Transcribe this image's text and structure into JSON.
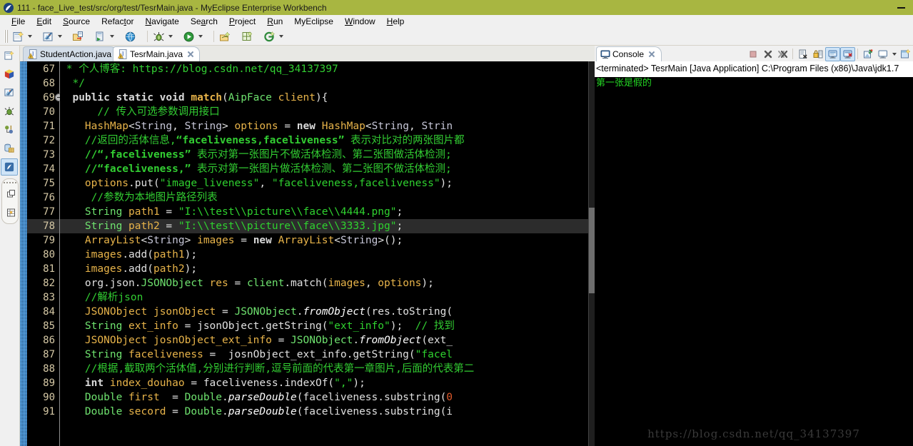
{
  "window": {
    "title": "111 - face_Live_test/src/org/test/TesrMain.java - MyEclipse Enterprise Workbench",
    "title_icon": "myeclipse-icon",
    "minimize_label": "minimize-button",
    "titlebar_color": "#a8b641"
  },
  "menubar": {
    "items": [
      {
        "label": "File",
        "mnemonic": "F"
      },
      {
        "label": "Edit",
        "mnemonic": "E"
      },
      {
        "label": "Source",
        "mnemonic": "S"
      },
      {
        "label": "Refactor",
        "mnemonic": "t"
      },
      {
        "label": "Navigate",
        "mnemonic": "N"
      },
      {
        "label": "Search",
        "mnemonic": "a"
      },
      {
        "label": "Project",
        "mnemonic": "P"
      },
      {
        "label": "Run",
        "mnemonic": "R"
      },
      {
        "label": "MyEclipse",
        "mnemonic": ""
      },
      {
        "label": "Window",
        "mnemonic": "W"
      },
      {
        "label": "Help",
        "mnemonic": "H"
      }
    ]
  },
  "toolbar": {
    "buttons": [
      {
        "name": "new-wizard-icon",
        "has_dropdown": true
      },
      {
        "name": "open-myeclipse-icon",
        "has_dropdown": true
      },
      {
        "name": "save-deploy-icon",
        "has_dropdown": false
      },
      {
        "name": "run-server-icon",
        "has_dropdown": true
      },
      {
        "name": "open-browser-icon",
        "has_dropdown": false
      },
      {
        "name": "debug-icon",
        "has_dropdown": true
      },
      {
        "name": "run-icon",
        "has_dropdown": true
      },
      {
        "name": "external-tools-icon",
        "has_dropdown": false
      },
      {
        "name": "new-window-icon",
        "has_dropdown": false
      },
      {
        "name": "search-git-icon",
        "has_dropdown": true
      }
    ]
  },
  "leftbar": {
    "items": [
      {
        "name": "new-wizard-icon",
        "selected": false
      },
      {
        "name": "package-cube-icon",
        "selected": false
      },
      {
        "name": "myeclipse-explorer-icon",
        "selected": false
      },
      {
        "name": "debug-bug-icon",
        "selected": false
      },
      {
        "name": "hierarchy-icon",
        "selected": false
      },
      {
        "name": "database-icon",
        "selected": false
      },
      {
        "name": "java-perspective-icon",
        "selected": true
      }
    ],
    "pill_items": [
      {
        "name": "restore-view-icon"
      },
      {
        "name": "table-view-icon"
      }
    ]
  },
  "editor": {
    "tabs": [
      {
        "label": "StudentAction.java",
        "icon": "java-warning-icon",
        "active": false,
        "closable": false
      },
      {
        "label": "TesrMain.java",
        "icon": "java-warning-icon",
        "active": true,
        "closable": true
      }
    ],
    "highlighted_line": 78,
    "fold_marker_line": 69,
    "first_line": 67,
    "lines": [
      {
        "n": 67,
        "tokens": [
          {
            "t": " * ",
            "c": "cmt"
          },
          {
            "t": "个人博客: https://blog.csdn.net/qq_34137397",
            "c": "cmt"
          }
        ]
      },
      {
        "n": 68,
        "tokens": [
          {
            "t": "  */",
            "c": "cmt"
          }
        ]
      },
      {
        "n": 69,
        "tokens": [
          {
            "t": "  ",
            "c": "plain"
          },
          {
            "t": "public static void ",
            "c": "kw"
          },
          {
            "t": "match",
            "c": "meth-b"
          },
          {
            "t": "(",
            "c": "plain"
          },
          {
            "t": "AipFace",
            "c": "type"
          },
          {
            "t": " client",
            "c": "var"
          },
          {
            "t": "){",
            "c": "plain"
          }
        ]
      },
      {
        "n": 70,
        "tokens": [
          {
            "t": "      ",
            "c": "plain"
          },
          {
            "t": "// 传入可选参数调用接口",
            "c": "cmt"
          }
        ]
      },
      {
        "n": 71,
        "tokens": [
          {
            "t": "    ",
            "c": "plain"
          },
          {
            "t": "HashMap",
            "c": "cls"
          },
          {
            "t": "<",
            "c": "plain"
          },
          {
            "t": "String",
            "c": "gen"
          },
          {
            "t": ", ",
            "c": "plain"
          },
          {
            "t": "String",
            "c": "gen"
          },
          {
            "t": "> ",
            "c": "plain"
          },
          {
            "t": "options",
            "c": "var"
          },
          {
            "t": " = ",
            "c": "plain"
          },
          {
            "t": "new",
            "c": "kw"
          },
          {
            "t": " ",
            "c": "plain"
          },
          {
            "t": "HashMap",
            "c": "cls"
          },
          {
            "t": "<",
            "c": "plain"
          },
          {
            "t": "String",
            "c": "gen"
          },
          {
            "t": ", ",
            "c": "plain"
          },
          {
            "t": "Strin",
            "c": "gen"
          }
        ]
      },
      {
        "n": 72,
        "tokens": [
          {
            "t": "    ",
            "c": "plain"
          },
          {
            "t": "//返回的活体信息,",
            "c": "cmt"
          },
          {
            "t": "“faceliveness,faceliveness”",
            "c": "cmt-b"
          },
          {
            "t": " 表示对比对的两张图片都",
            "c": "cmt"
          }
        ]
      },
      {
        "n": 73,
        "tokens": [
          {
            "t": "    ",
            "c": "plain"
          },
          {
            "t": "//“,faceliveness”",
            "c": "cmt-b"
          },
          {
            "t": " 表示对第一张图片不做活体检测、第二张图做活体检测;",
            "c": "cmt"
          }
        ]
      },
      {
        "n": 74,
        "tokens": [
          {
            "t": "    ",
            "c": "plain"
          },
          {
            "t": "//“faceliveness,”",
            "c": "cmt-b"
          },
          {
            "t": " 表示对第一张图片做活体检测、第二张图不做活体检测;",
            "c": "cmt"
          }
        ]
      },
      {
        "n": 75,
        "tokens": [
          {
            "t": "    ",
            "c": "plain"
          },
          {
            "t": "options",
            "c": "var"
          },
          {
            "t": ".put(",
            "c": "plain"
          },
          {
            "t": "\"image_liveness\"",
            "c": "str"
          },
          {
            "t": ", ",
            "c": "plain"
          },
          {
            "t": "\"faceliveness,faceliveness\"",
            "c": "str"
          },
          {
            "t": ");",
            "c": "plain"
          }
        ]
      },
      {
        "n": 76,
        "tokens": [
          {
            "t": "     ",
            "c": "plain"
          },
          {
            "t": "//参数为本地图片路径列表",
            "c": "cmt"
          }
        ]
      },
      {
        "n": 77,
        "tokens": [
          {
            "t": "    ",
            "c": "plain"
          },
          {
            "t": "String",
            "c": "type"
          },
          {
            "t": " path1",
            "c": "var"
          },
          {
            "t": " = ",
            "c": "plain"
          },
          {
            "t": "\"I:\\\\test\\\\picture\\\\face\\\\4444.png\"",
            "c": "str"
          },
          {
            "t": ";",
            "c": "plain"
          }
        ]
      },
      {
        "n": 78,
        "tokens": [
          {
            "t": "    ",
            "c": "plain"
          },
          {
            "t": "String",
            "c": "type"
          },
          {
            "t": " path2",
            "c": "var"
          },
          {
            "t": " = ",
            "c": "plain"
          },
          {
            "t": "\"I:\\\\test\\\\picture\\\\face\\\\3333.jpg\"",
            "c": "str"
          },
          {
            "t": ";",
            "c": "plain"
          }
        ]
      },
      {
        "n": 79,
        "tokens": [
          {
            "t": "    ",
            "c": "plain"
          },
          {
            "t": "ArrayList",
            "c": "cls"
          },
          {
            "t": "<",
            "c": "plain"
          },
          {
            "t": "String",
            "c": "gen"
          },
          {
            "t": "> ",
            "c": "plain"
          },
          {
            "t": "images",
            "c": "var"
          },
          {
            "t": " = ",
            "c": "plain"
          },
          {
            "t": "new",
            "c": "kw"
          },
          {
            "t": " ",
            "c": "plain"
          },
          {
            "t": "ArrayList",
            "c": "cls"
          },
          {
            "t": "<",
            "c": "plain"
          },
          {
            "t": "String",
            "c": "gen"
          },
          {
            "t": ">();",
            "c": "plain"
          }
        ]
      },
      {
        "n": 80,
        "tokens": [
          {
            "t": "    ",
            "c": "plain"
          },
          {
            "t": "images",
            "c": "var"
          },
          {
            "t": ".add(",
            "c": "plain"
          },
          {
            "t": "path1",
            "c": "var"
          },
          {
            "t": ");",
            "c": "plain"
          }
        ]
      },
      {
        "n": 81,
        "tokens": [
          {
            "t": "    ",
            "c": "plain"
          },
          {
            "t": "images",
            "c": "var"
          },
          {
            "t": ".add(",
            "c": "plain"
          },
          {
            "t": "path2",
            "c": "var"
          },
          {
            "t": ");",
            "c": "plain"
          }
        ]
      },
      {
        "n": 82,
        "tokens": [
          {
            "t": "    ",
            "c": "plain"
          },
          {
            "t": "org.json.",
            "c": "plain"
          },
          {
            "t": "JSONObject",
            "c": "type"
          },
          {
            "t": " res",
            "c": "var"
          },
          {
            "t": " = ",
            "c": "plain"
          },
          {
            "t": "client",
            "c": "type"
          },
          {
            "t": ".match(",
            "c": "plain"
          },
          {
            "t": "images",
            "c": "var"
          },
          {
            "t": ", ",
            "c": "plain"
          },
          {
            "t": "options",
            "c": "var"
          },
          {
            "t": ");",
            "c": "plain"
          }
        ]
      },
      {
        "n": 83,
        "tokens": [
          {
            "t": "    ",
            "c": "plain"
          },
          {
            "t": "//解析json",
            "c": "cmt"
          }
        ]
      },
      {
        "n": 84,
        "tokens": [
          {
            "t": "    ",
            "c": "plain"
          },
          {
            "t": "JSONObject",
            "c": "cls"
          },
          {
            "t": " jsonObject",
            "c": "var"
          },
          {
            "t": " = ",
            "c": "plain"
          },
          {
            "t": "JSONObject",
            "c": "type"
          },
          {
            "t": ".",
            "c": "plain"
          },
          {
            "t": "fromObject",
            "c": "italic"
          },
          {
            "t": "(res.toString(",
            "c": "plain"
          }
        ]
      },
      {
        "n": 85,
        "tokens": [
          {
            "t": "    ",
            "c": "plain"
          },
          {
            "t": "String",
            "c": "type"
          },
          {
            "t": " ext_info",
            "c": "var"
          },
          {
            "t": " = ",
            "c": "plain"
          },
          {
            "t": "jsonObject.getString(",
            "c": "plain"
          },
          {
            "t": "\"ext_info\"",
            "c": "str"
          },
          {
            "t": ");  ",
            "c": "plain"
          },
          {
            "t": "// 找到",
            "c": "cmt"
          }
        ]
      },
      {
        "n": 86,
        "tokens": [
          {
            "t": "    ",
            "c": "plain"
          },
          {
            "t": "JSONObject",
            "c": "cls"
          },
          {
            "t": " josnObject_ext_info",
            "c": "var"
          },
          {
            "t": " = ",
            "c": "plain"
          },
          {
            "t": "JSONObject",
            "c": "type"
          },
          {
            "t": ".",
            "c": "plain"
          },
          {
            "t": "fromObject",
            "c": "italic"
          },
          {
            "t": "(ext_",
            "c": "plain"
          }
        ]
      },
      {
        "n": 87,
        "tokens": [
          {
            "t": "    ",
            "c": "plain"
          },
          {
            "t": "String",
            "c": "type"
          },
          {
            "t": " faceliveness",
            "c": "var"
          },
          {
            "t": " =  ",
            "c": "plain"
          },
          {
            "t": "josnObject_ext_info.getString(",
            "c": "plain"
          },
          {
            "t": "\"facel",
            "c": "str"
          }
        ]
      },
      {
        "n": 88,
        "tokens": [
          {
            "t": "    ",
            "c": "plain"
          },
          {
            "t": "//根据,截取两个活体值,分别进行判断,逗号前面的代表第一章图片,后面的代表第二",
            "c": "cmt"
          }
        ]
      },
      {
        "n": 89,
        "tokens": [
          {
            "t": "    ",
            "c": "plain"
          },
          {
            "t": "int",
            "c": "kw"
          },
          {
            "t": " index_douhao",
            "c": "var"
          },
          {
            "t": " = ",
            "c": "plain"
          },
          {
            "t": "faceliveness.indexOf(",
            "c": "plain"
          },
          {
            "t": "\",\"",
            "c": "str"
          },
          {
            "t": ");",
            "c": "plain"
          }
        ]
      },
      {
        "n": 90,
        "tokens": [
          {
            "t": "    ",
            "c": "plain"
          },
          {
            "t": "Double",
            "c": "type"
          },
          {
            "t": " first",
            "c": "var"
          },
          {
            "t": "  = ",
            "c": "plain"
          },
          {
            "t": "Double",
            "c": "type"
          },
          {
            "t": ".",
            "c": "plain"
          },
          {
            "t": "parseDouble",
            "c": "italic"
          },
          {
            "t": "(faceliveness.substring(",
            "c": "plain"
          },
          {
            "t": "0",
            "c": "num"
          }
        ]
      },
      {
        "n": 91,
        "tokens": [
          {
            "t": "    ",
            "c": "plain"
          },
          {
            "t": "Double",
            "c": "type"
          },
          {
            "t": " secord",
            "c": "var"
          },
          {
            "t": " = ",
            "c": "plain"
          },
          {
            "t": "Double",
            "c": "type"
          },
          {
            "t": ".",
            "c": "plain"
          },
          {
            "t": "parseDouble",
            "c": "italic"
          },
          {
            "t": "(faceliveness.substring(i",
            "c": "plain"
          }
        ]
      }
    ]
  },
  "console": {
    "tab_label": "Console",
    "tab_icon": "console-icon",
    "tab_close_icon": "close-icon",
    "toolbar": [
      {
        "name": "terminate-icon",
        "active": false
      },
      {
        "name": "remove-launch-icon",
        "active": false
      },
      {
        "name": "remove-all-terminated-icon",
        "active": false
      },
      {
        "name": "clear-console-icon",
        "active": false
      },
      {
        "name": "scroll-lock-icon",
        "active": false
      },
      {
        "name": "show-console-on-output-icon",
        "active": true
      },
      {
        "name": "show-console-on-error-icon",
        "active": true
      },
      {
        "name": "pin-console-icon",
        "active": false
      },
      {
        "name": "display-selected-console-icon",
        "active": false,
        "has_dropdown": true
      },
      {
        "name": "open-console-icon",
        "active": false
      }
    ],
    "status_line": "<terminated> TesrMain [Java Application] C:\\Program Files (x86)\\Java\\jdk1.7",
    "output_lines": [
      "第一张是假的"
    ],
    "output_color": "#23d423"
  },
  "watermark": {
    "text": "https://blog.csdn.net/qq_34137397"
  }
}
